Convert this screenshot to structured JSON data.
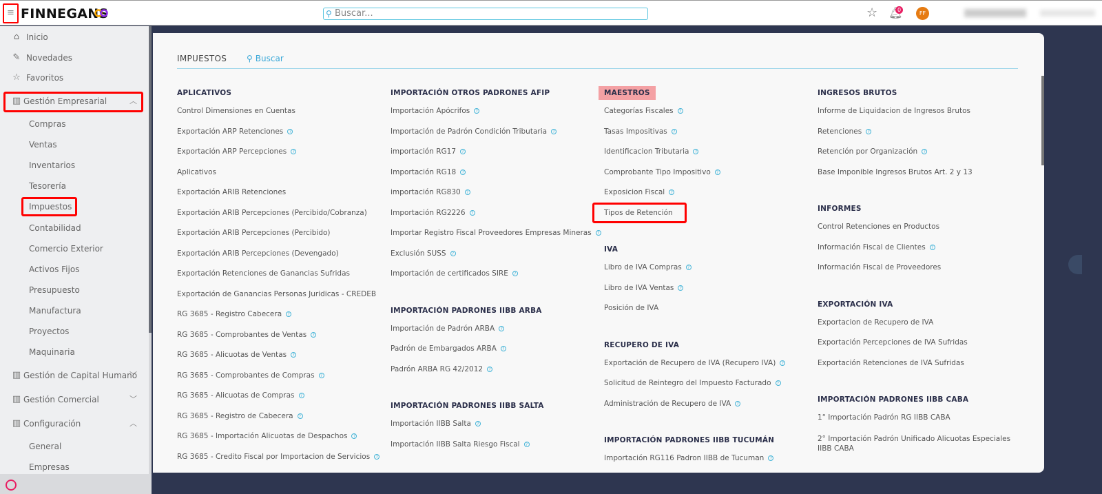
{
  "header": {
    "brand": "FINNEGANS",
    "search_placeholder": "Buscar...",
    "notifications_count": "0",
    "avatar_initials": "FF"
  },
  "sidebar": {
    "top": [
      {
        "label": "Inicio",
        "icon": "home-icon"
      },
      {
        "label": "Novedades",
        "icon": "pin-icon"
      },
      {
        "label": "Favoritos",
        "icon": "star-icon"
      }
    ],
    "groups": [
      {
        "label": "Gestión Empresarial",
        "expanded": true,
        "items": [
          "Compras",
          "Ventas",
          "Inventarios",
          "Tesorería",
          "Impuestos",
          "Contabilidad",
          "Comercio Exterior",
          "Activos Fijos",
          "Presupuesto",
          "Manufactura",
          "Proyectos",
          "Maquinaria"
        ]
      },
      {
        "label": "Gestión de Capital Humano",
        "expanded": false
      },
      {
        "label": "Gestión Comercial",
        "expanded": false
      },
      {
        "label": "Configuración",
        "expanded": true,
        "items": [
          "General",
          "Empresas"
        ]
      }
    ]
  },
  "panel": {
    "title": "IMPUESTOS",
    "search_label": "Buscar",
    "columns": [
      [
        {
          "title": "APLICATIVOS",
          "items": [
            {
              "label": "Control Dimensiones en Cuentas",
              "help": false
            },
            {
              "label": "Exportación ARP Retenciones",
              "help": true
            },
            {
              "label": "Exportación ARP Percepciones",
              "help": true
            },
            {
              "label": "Aplicativos",
              "help": false
            },
            {
              "label": "Exportación ARIB Retenciones",
              "help": false
            },
            {
              "label": "Exportación ARIB Percepciones (Percibido/Cobranza)",
              "help": false
            },
            {
              "label": "Exportación ARIB Percepciones (Percibido)",
              "help": false
            },
            {
              "label": "Exportación ARIB Percepciones (Devengado)",
              "help": false
            },
            {
              "label": "Exportación Retenciones de Ganancias Sufridas",
              "help": false
            },
            {
              "label": "Exportación de Ganancias Personas Juridicas - CREDEB",
              "help": false
            },
            {
              "label": "RG 3685 - Registro Cabecera",
              "help": true
            },
            {
              "label": "RG 3685 - Comprobantes de Ventas",
              "help": true
            },
            {
              "label": "RG 3685 - Alicuotas de Ventas",
              "help": true
            },
            {
              "label": "RG 3685 - Comprobantes de Compras",
              "help": true
            },
            {
              "label": "RG 3685 - Alicuotas de Compras",
              "help": true
            },
            {
              "label": "RG 3685 - Registro de Cabecera",
              "help": true
            },
            {
              "label": "RG 3685 - Importación Alicuotas de Despachos",
              "help": true
            },
            {
              "label": "RG 3685 - Credito Fiscal por Importacion de Servicios",
              "help": true
            }
          ]
        }
      ],
      [
        {
          "title": "IMPORTACIÓN OTROS PADRONES AFIP",
          "items": [
            {
              "label": "Importación Apócrifos",
              "help": true
            },
            {
              "label": "Importación de Padrón Condición Tributaria",
              "help": true
            },
            {
              "label": "importación RG17",
              "help": true
            },
            {
              "label": "Importación RG18",
              "help": true
            },
            {
              "label": "importación RG830",
              "help": true
            },
            {
              "label": "Importación RG2226",
              "help": true
            },
            {
              "label": "Importar Registro Fiscal Proveedores Empresas Mineras",
              "help": true
            },
            {
              "label": "Exclusión SUSS",
              "help": true
            },
            {
              "label": "Importación de certificados SIRE",
              "help": true
            }
          ]
        },
        {
          "title": "IMPORTACIÓN PADRONES IIBB ARBA",
          "items": [
            {
              "label": "Importación de Padrón ARBA",
              "help": true
            },
            {
              "label": "Padrón de Embargados ARBA",
              "help": true
            },
            {
              "label": "Padrón ARBA RG 42/2012",
              "help": true
            }
          ]
        },
        {
          "title": "IMPORTACIÓN PADRONES IIBB SALTA",
          "items": [
            {
              "label": "Importación IIBB Salta",
              "help": true
            },
            {
              "label": "Importación IIBB Salta Riesgo Fiscal",
              "help": true
            }
          ]
        }
      ],
      [
        {
          "title": "MAESTROS",
          "highlighted": true,
          "items": [
            {
              "label": "Categorías Fiscales",
              "help": true
            },
            {
              "label": "Tasas Impositivas",
              "help": true
            },
            {
              "label": "Identificacion Tributaria",
              "help": true
            },
            {
              "label": "Comprobante Tipo Impositivo",
              "help": true
            },
            {
              "label": "Exposicion Fiscal",
              "help": true
            },
            {
              "label": "Tipos de Retención",
              "help": false
            }
          ]
        },
        {
          "title": "IVA",
          "items": [
            {
              "label": "Libro de IVA Compras",
              "help": true
            },
            {
              "label": "Libro de IVA Ventas",
              "help": true
            },
            {
              "label": "Posición de IVA",
              "help": false
            }
          ]
        },
        {
          "title": "RECUPERO DE IVA",
          "items": [
            {
              "label": "Exportación de Recupero de IVA (Recupero IVA)",
              "help": true
            },
            {
              "label": "Solicitud de Reintegro del Impuesto Facturado",
              "help": true
            },
            {
              "label": "Administración de Recupero de IVA",
              "help": true
            }
          ]
        },
        {
          "title": "IMPORTACIÓN PADRONES IIBB TUCUMÁN",
          "items": [
            {
              "label": "Importación RG116 Padron IIBB de Tucuman",
              "help": true
            }
          ]
        }
      ],
      [
        {
          "title": "INGRESOS BRUTOS",
          "items": [
            {
              "label": "Informe de Liquidacion de Ingresos Brutos",
              "help": false
            },
            {
              "label": "Retenciones",
              "help": true
            },
            {
              "label": "Retención por Organización",
              "help": true
            },
            {
              "label": "Base Imponible Ingresos Brutos Art. 2 y 13",
              "help": false
            }
          ]
        },
        {
          "title": "INFORMES",
          "items": [
            {
              "label": "Control Retenciones en Productos",
              "help": false
            },
            {
              "label": "Información Fiscal de Clientes",
              "help": true
            },
            {
              "label": "Información Fiscal de Proveedores",
              "help": false
            }
          ]
        },
        {
          "title": "EXPORTACIÓN IVA",
          "items": [
            {
              "label": "Exportacion de Recupero de IVA",
              "help": false
            },
            {
              "label": "Exportación Percepciones de IVA Sufridas",
              "help": false
            },
            {
              "label": "Exportación Retenciones de IVA Sufridas",
              "help": false
            }
          ]
        },
        {
          "title": "IMPORTACIÓN PADRONES IIBB CABA",
          "items": [
            {
              "label": "1° Importación Padrón RG IIBB CABA",
              "help": false
            },
            {
              "label": "2° Importación Padrón Unificado Alicuotas Especiales IIBB CABA",
              "help": false
            }
          ]
        }
      ]
    ]
  },
  "colors": {
    "accent": "#44b4d8",
    "highlight": "#f4a1a4",
    "background": "#2e3650",
    "marker": "#ff0000"
  }
}
